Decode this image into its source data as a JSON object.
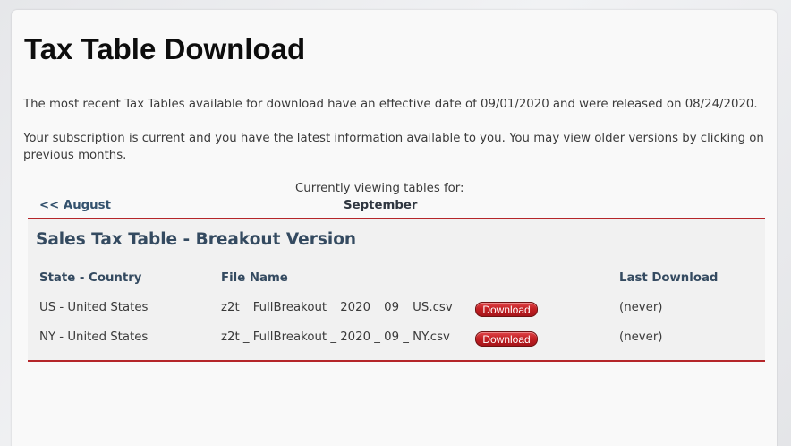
{
  "page": {
    "title": "Tax Table Download",
    "intro": "The most recent Tax Tables available for download have an effective date of 09/01/2020 and were released on 08/24/2020.",
    "subscription": "Your subscription is current and you have the latest information available to you. You may view older versions by clicking on previous months."
  },
  "nav": {
    "viewing_label": "Currently viewing tables for:",
    "prev_month": "<< August",
    "current_month": "September"
  },
  "table": {
    "title": "Sales Tax Table - Breakout Version",
    "columns": [
      "State - Country",
      "File Name",
      "Last Download"
    ],
    "rows": [
      {
        "state": "US - United States",
        "file": "z2t _ FullBreakout _ 2020 _ 09 _ US.csv",
        "action": "Download",
        "last_download": "(never)"
      },
      {
        "state": "NY - United States",
        "file": "z2t _ FullBreakout _ 2020 _ 09 _ NY.csv",
        "action": "Download",
        "last_download": "(never)"
      }
    ]
  },
  "colors": {
    "accent_red": "#b5262a",
    "heading_blue": "#344a60",
    "button_red": "#c42024"
  }
}
